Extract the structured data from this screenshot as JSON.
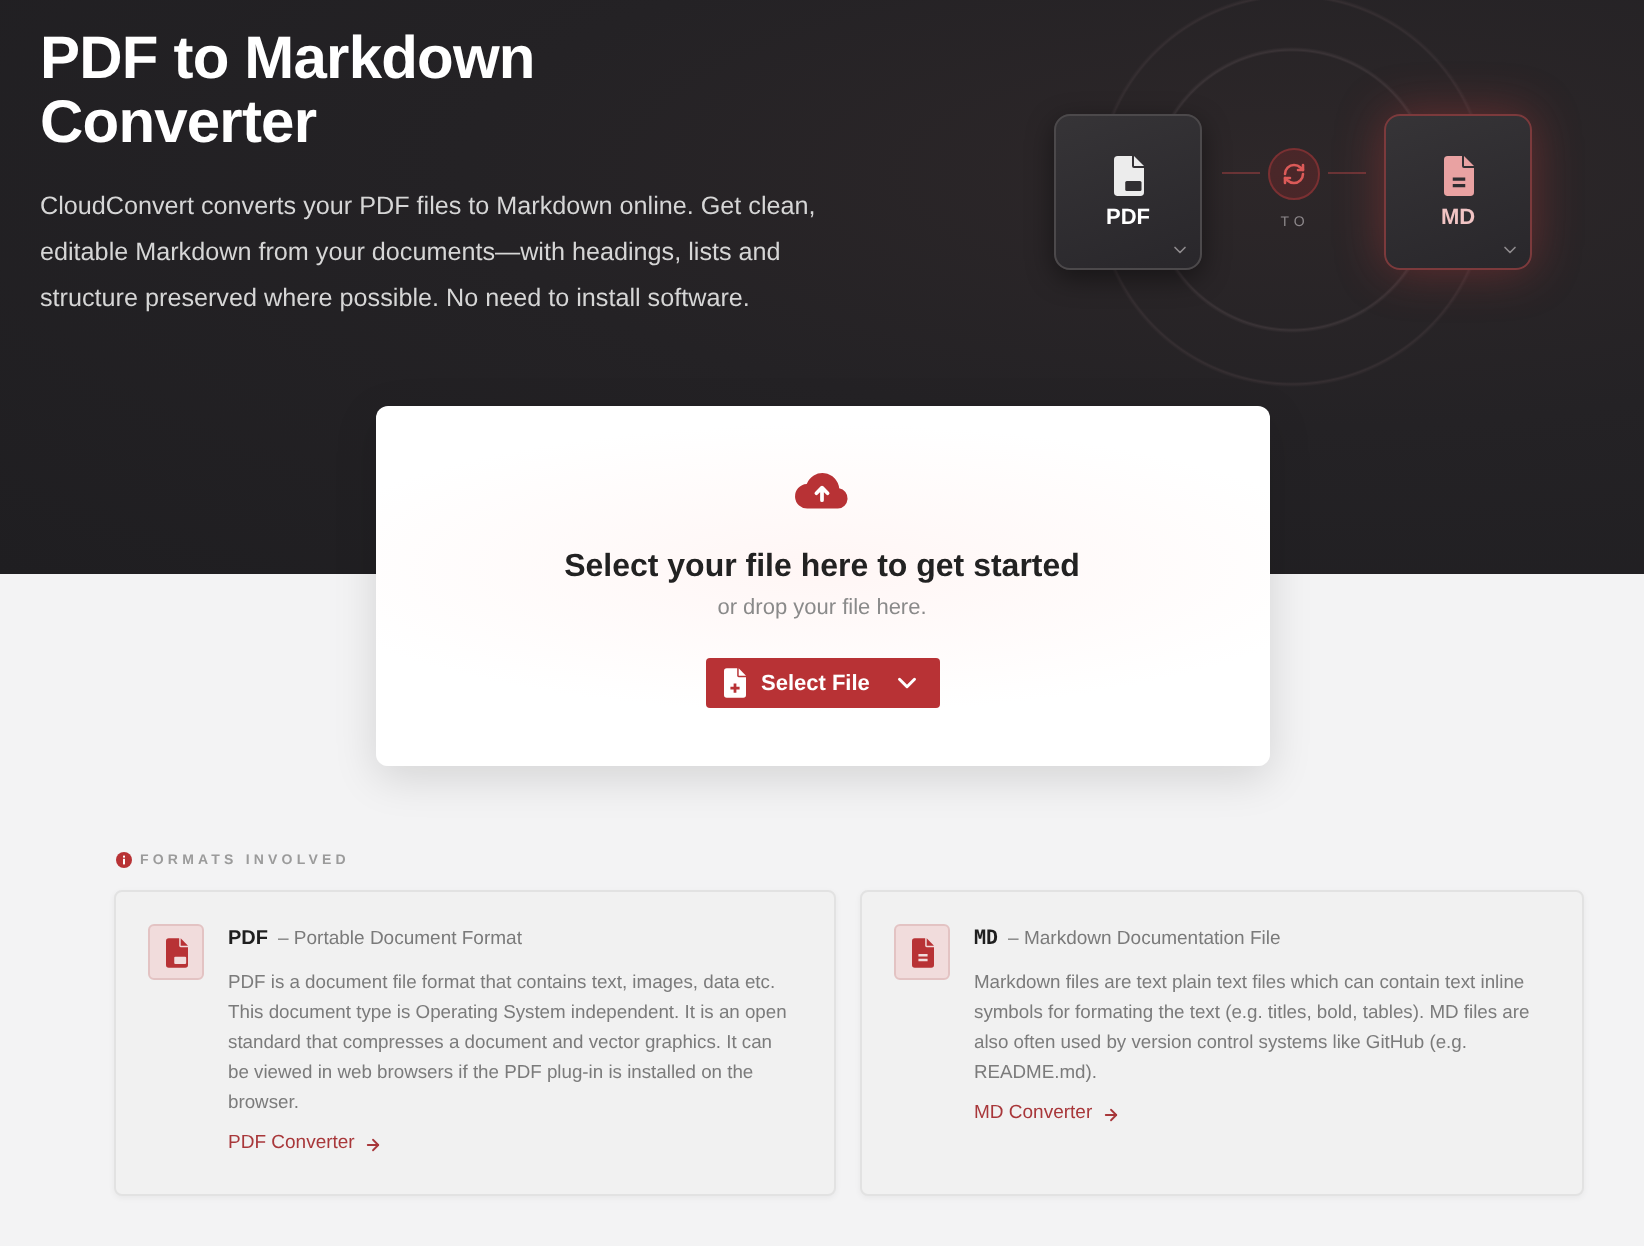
{
  "hero": {
    "title": "PDF to Markdown Converter",
    "description": "CloudConvert converts your PDF files to Markdown online. Get clean, editable Markdown from your documents—with headings, lists and structure preserved where possible. No need to install software."
  },
  "conversion": {
    "source": {
      "kind": "pdf",
      "label": "PDF",
      "highlighted": false
    },
    "connector": "TO",
    "target": {
      "kind": "md",
      "label": "MD",
      "highlighted": true
    }
  },
  "upload": {
    "heading": "Select your file here to get started",
    "subtext": "or drop your file here.",
    "button": "Select File"
  },
  "formats": {
    "heading": "FORMATS INVOLVED",
    "items": [
      {
        "kind": "pdf",
        "code": "PDF",
        "name": "– Portable Document Format",
        "description": "PDF is a document file format that contains text, images, data etc. This document type is Operating System independent. It is an open standard that compresses a document and vector graphics. It can be viewed in web browsers if the PDF plug-in is installed on the browser.",
        "link": "PDF Converter"
      },
      {
        "kind": "md",
        "code": "MD",
        "name": "– Markdown Documentation File",
        "description": "Markdown files are text plain text files which can contain text inline symbols for formating the text (e.g. titles, bold, tables). MD files are also often used by version control systems like GitHub (e.g. README.md).",
        "link": "MD Converter"
      }
    ]
  }
}
